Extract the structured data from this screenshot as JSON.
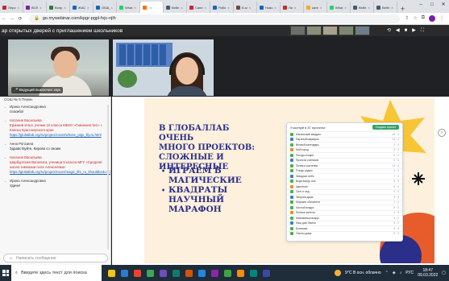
{
  "browser": {
    "tabs": [
      {
        "label": "Опро",
        "color": "#c62828"
      },
      {
        "label": "ВОЛ",
        "color": "#7b1fa2"
      },
      {
        "label": "Вопр",
        "color": "#2e7d32"
      },
      {
        "label": "ЖАС",
        "color": "#1565c0"
      },
      {
        "label": "ОБЩ",
        "color": "#1565c0"
      },
      {
        "label": "What",
        "color": "#25d366"
      },
      {
        "label": "",
        "color": "#ff6d00",
        "active": true
      },
      {
        "label": "Вебн",
        "color": "#455a64"
      },
      {
        "label": "Санп",
        "color": "#c62828"
      },
      {
        "label": "Рабо",
        "color": "#1565c0"
      },
      {
        "label": "Б-м",
        "color": "#6d4c41"
      },
      {
        "label": "Ново",
        "color": "#1565c0"
      },
      {
        "label": "Ли",
        "color": "#c62828"
      },
      {
        "label": "кате",
        "color": "#f9a825"
      },
      {
        "label": "What",
        "color": "#25d366"
      },
      {
        "label": "Вебн",
        "color": "#455a64"
      },
      {
        "label": "Вебн",
        "color": "#455a64"
      }
    ],
    "url": "go.mywebinar.com/kpgr-pgpl-fvjc-njlh",
    "window_controls": [
      "–",
      "□",
      "✕"
    ]
  },
  "webinar": {
    "title": "ар открытых дверей с приглашением школьников",
    "controls": [
      "⟲",
      "◀",
      "■",
      "▶",
      "⛶"
    ]
  },
  "videos": {
    "presenter_label": "Ведущий выключил звук",
    "presenter_mic_icon": "muted-mic-icon"
  },
  "chat": {
    "header": "СОШ № 9 Пермь",
    "messages": [
      {
        "author": "Ирина Александровна",
        "text": "спасибо!",
        "red": false
      },
      {
        "author": "Наталия Васильева",
        "text": "Ермаков Илья, ученик 10 класса МБОУ «Гимназия №1» г. Канска Красноярского края",
        "link": "https://globallab.org/ru/project/cover/whose_pigs_lily.ru.html",
        "red": true
      },
      {
        "author": "Анна Рогозина",
        "text": "Здравствуйте, Кирова со своим",
        "red": false
      },
      {
        "author": "Наталия Васильева",
        "text": "Ширбургская Василиса, ученица 5 класса МГУ «Средняя школа гимназии села Алексеевка»",
        "link": "https://globallab.org/ru/project/cover/magic_life_ru_khouldlook.ru.html",
        "red": true
      },
      {
        "author": "Ирина Александровна",
        "text": "Удачи!",
        "red": false
      }
    ],
    "input_placeholder": "Написать сообщение"
  },
  "slide": {
    "title_lines": [
      "В ГЛОБАЛЛАБ ОЧЕНЬ",
      "МНОГО ПРОЕКТОВ:",
      "СЛОЖНЫЕ И",
      "ИНТЕРЕСНЫЕ"
    ],
    "bullets": [
      [
        "ИГРАЕМ В",
        "МАГИЧЕСКИЕ",
        "КВАДРАТЫ"
      ],
      [
        "НАУЧНЫЙ",
        "МАРАФОН"
      ]
    ],
    "screenshot": {
      "header": "Участвуй в 37 проектах",
      "button": "Создать проект",
      "rows": [
        {
          "name": "Магический квадрат",
          "tag": "43 · 0",
          "icon": "g"
        },
        {
          "name": "Научный марафон",
          "tag": "14 · 0",
          "icon": "b"
        },
        {
          "name": "Вечный календарь",
          "tag": "2 · 0",
          "icon": "g"
        },
        {
          "name": "Мой город",
          "tag": "9 · 0",
          "icon": "o"
        },
        {
          "name": "Погода в мире",
          "tag": "6 · 0",
          "icon": "g"
        },
        {
          "name": "Проекты учеников",
          "tag": "3 · 0",
          "icon": "b"
        },
        {
          "name": "Почва и растения",
          "tag": "12 · 0",
          "icon": "g"
        },
        {
          "name": "Птицы рядом",
          "tag": "4 · 0",
          "icon": "g"
        },
        {
          "name": "Звездное небо",
          "tag": "7 · 0",
          "icon": "b"
        },
        {
          "name": "Вода вокруг нас",
          "tag": "5 · 0",
          "icon": "g"
        },
        {
          "name": "Цветение",
          "tag": "8 · 0",
          "icon": "o"
        },
        {
          "name": "Снег и лед",
          "tag": "2 · 0",
          "icon": "g"
        },
        {
          "name": "Энергия дома",
          "tag": "3 · 0",
          "icon": "b"
        },
        {
          "name": "Морские обитатели",
          "tag": "1 · 0",
          "icon": "g"
        },
        {
          "name": "Чистый воздух",
          "tag": "6 · 0",
          "icon": "g"
        },
        {
          "name": "Лесные жители",
          "tag": "2 · 0",
          "icon": "o"
        },
        {
          "name": "Математика вокруг",
          "tag": "4 · 0",
          "icon": "g"
        },
        {
          "name": "Наш дом Земля",
          "tag": "9 · 0",
          "icon": "b"
        },
        {
          "name": "Ботаника",
          "tag": "3 · 0",
          "icon": "g"
        },
        {
          "name": "Опыты дома",
          "tag": "5 · 0",
          "icon": "g"
        }
      ]
    }
  },
  "taskbar": {
    "search_placeholder": "Введите здесь текст для поиска",
    "weather": "9°С  В осн. облачно",
    "lang": "РУС",
    "time": "18:47",
    "date": "09.03.2022",
    "apps": [
      "#f0c419",
      "#2b7cd3",
      "#e8442e",
      "#3aa757",
      "#6b4fbb",
      "#0f7b6c",
      "#d35400",
      "#1e88e5",
      "#8e24aa",
      "#43a047",
      "#fb8c00",
      "#00897b",
      "#3949ab"
    ]
  }
}
